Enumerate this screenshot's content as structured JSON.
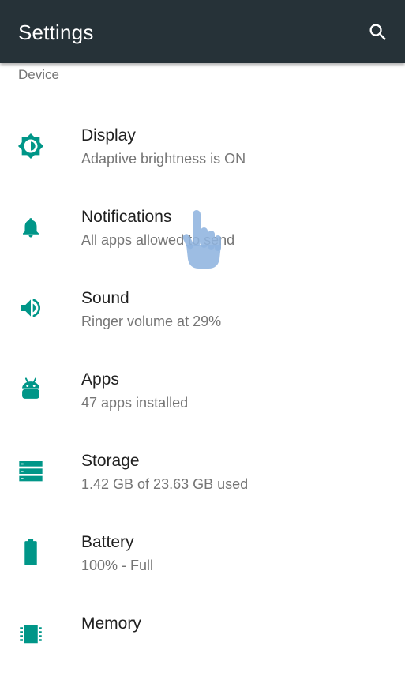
{
  "toolbar": {
    "title": "Settings",
    "background": "#263238",
    "search_icon": "search-icon"
  },
  "section": {
    "header": "Device"
  },
  "accent_color": "#009688",
  "items": [
    {
      "title": "Display",
      "summary": "Adaptive brightness is ON",
      "icon": "brightness-icon"
    },
    {
      "title": "Notifications",
      "summary": "All apps allowed to send",
      "icon": "bell-icon"
    },
    {
      "title": "Sound",
      "summary": "Ringer volume at 29%",
      "icon": "volume-icon"
    },
    {
      "title": "Apps",
      "summary": "47 apps installed",
      "icon": "android-icon"
    },
    {
      "title": "Storage",
      "summary": "1.42 GB of 23.63 GB used",
      "icon": "storage-icon"
    },
    {
      "title": "Battery",
      "summary": "100% - Full",
      "icon": "battery-icon"
    },
    {
      "title": "Memory",
      "summary": "",
      "icon": "memory-chip-icon"
    }
  ],
  "touch_indicator": "hand-pointer-icon"
}
